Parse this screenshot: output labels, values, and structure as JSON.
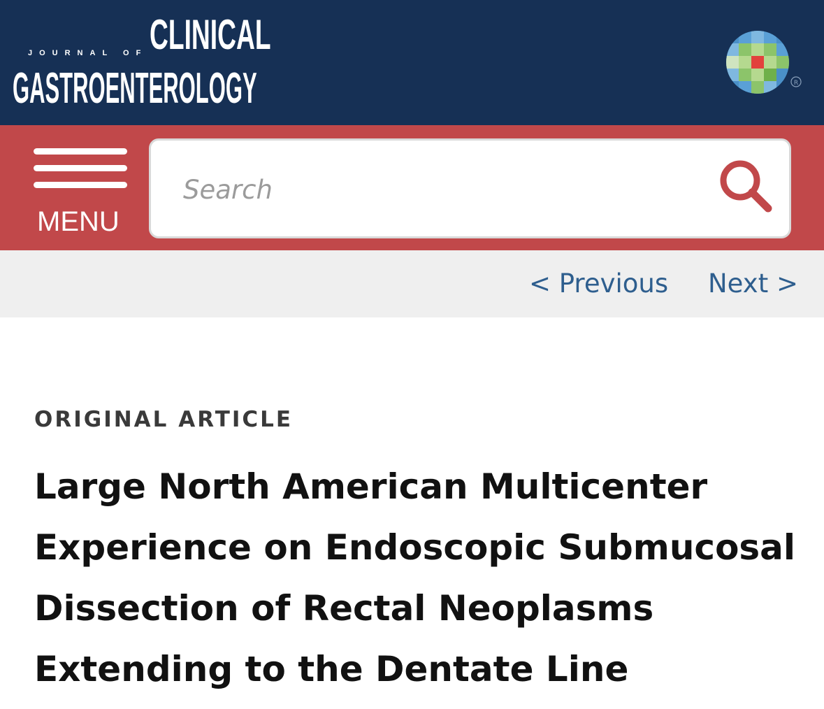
{
  "header": {
    "journal_prefix": "JOURNAL OF",
    "journal_name_line1": "CLINICAL",
    "journal_name_line2": "GASTROENTEROLOGY",
    "brand_mark_icon": "publisher-pixel-globe-icon",
    "registered_mark": "®",
    "background_color": "#163055"
  },
  "searchbar": {
    "background_color": "#c1484a",
    "menu_icon": "hamburger-icon",
    "menu_label": "MENU",
    "search_placeholder": "Search",
    "search_icon": "search-icon"
  },
  "nav": {
    "previous_label": "< Previous",
    "next_label": "Next >",
    "link_color": "#2e5e8e"
  },
  "article": {
    "type_label": "ORIGINAL ARTICLE",
    "title_lines": [
      "Large North American Multicenter",
      "Experience on Endoscopic Submucosal",
      "Dissection of Rectal Neoplasms",
      "Extending to the Dentate Line"
    ]
  }
}
